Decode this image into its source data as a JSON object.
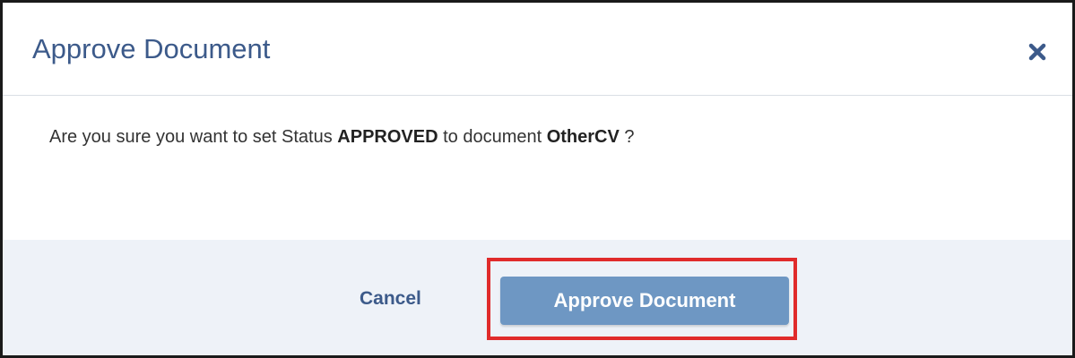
{
  "dialog": {
    "title": "Approve Document",
    "close_icon": "close-icon",
    "message": {
      "prefix": "Are you sure you want to set Status ",
      "status": "APPROVED",
      "middle": " to document ",
      "document": "OtherCV",
      "suffix": " ?"
    },
    "footer": {
      "cancel_label": "Cancel",
      "approve_label": "Approve Document"
    }
  },
  "colors": {
    "title": "#3c5a8a",
    "footer_bg": "#eef2f8",
    "approve_button": "#6e97c3",
    "highlight": "#e02b2b"
  }
}
